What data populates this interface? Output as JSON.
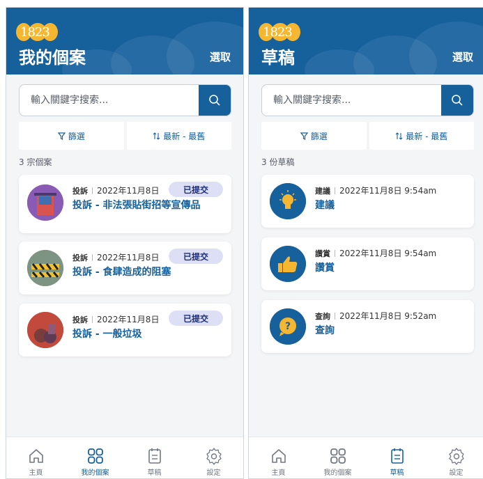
{
  "logo_text": "1823",
  "search_placeholder": "輸入關鍵字搜索...",
  "filter_label": "篩選",
  "sort_label": "最新 - 最舊",
  "select_label": "選取",
  "colors": {
    "primary": "#16609c",
    "logo": "#f5b731",
    "badge_bg": "#dde0f5",
    "badge_text": "#1c2e7a"
  },
  "nav": [
    {
      "label": "主頁",
      "icon": "home-icon"
    },
    {
      "label": "我的個案",
      "icon": "grid-icon"
    },
    {
      "label": "草稿",
      "icon": "clipboard-icon"
    },
    {
      "label": "設定",
      "icon": "gear-icon"
    }
  ],
  "screens": [
    {
      "title": "我的個案",
      "count": "3 宗個案",
      "active_nav": "我的個案",
      "cards": [
        {
          "category": "投訴",
          "date": "2022年11月8日",
          "status": "已提交",
          "title": "投訴 - 非法張貼街招等宣傳品",
          "icon": "poster-image"
        },
        {
          "category": "投訴",
          "date": "2022年11月8日",
          "status": "已提交",
          "title": "投訴 - 食肆造成的阻塞",
          "icon": "barrier-image"
        },
        {
          "category": "投訴",
          "date": "2022年11月8日",
          "status": "已提交",
          "title": "投訴 - 一般垃圾",
          "icon": "garbage-image"
        }
      ]
    },
    {
      "title": "草稿",
      "count": "3 份草稿",
      "active_nav": "草稿",
      "cards": [
        {
          "category": "建議",
          "date": "2022年11月8日 9:54am",
          "title": "建議",
          "icon": "lightbulb-icon"
        },
        {
          "category": "讚賞",
          "date": "2022年11月8日 9:54am",
          "title": "讚賞",
          "icon": "thumbs-up-icon"
        },
        {
          "category": "查詢",
          "date": "2022年11月8日 9:52am",
          "title": "查詢",
          "icon": "question-bubble-icon"
        }
      ]
    }
  ]
}
